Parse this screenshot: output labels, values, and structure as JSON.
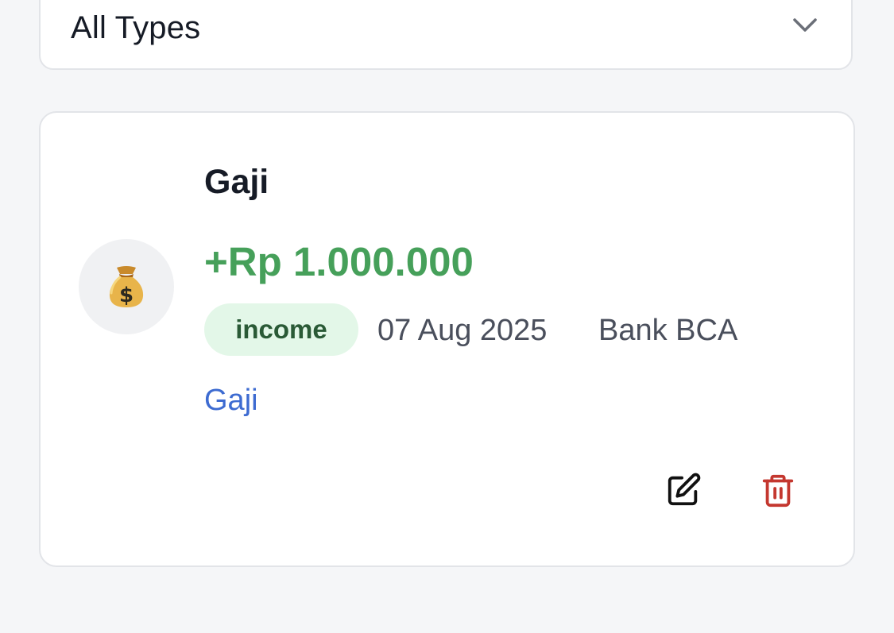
{
  "filter": {
    "type_label": "All Types",
    "icon": "chevron-down-icon"
  },
  "transactions": [
    {
      "icon": "money-bag-icon",
      "emoji": "💰",
      "title": "Gaji",
      "amount": "+Rp 1.000.000",
      "type": "income",
      "date": "07 Aug 2025",
      "account": "Bank BCA",
      "category": "Gaji",
      "actions": {
        "edit_icon": "edit-icon",
        "delete_icon": "trash-icon"
      }
    }
  ],
  "colors": {
    "income_amount": "#46a05a",
    "income_badge_bg": "#e3f7e8",
    "income_badge_text": "#2a5a36",
    "category_link": "#3d6bd1",
    "delete": "#c4372f",
    "page_bg": "#f5f6f8"
  }
}
